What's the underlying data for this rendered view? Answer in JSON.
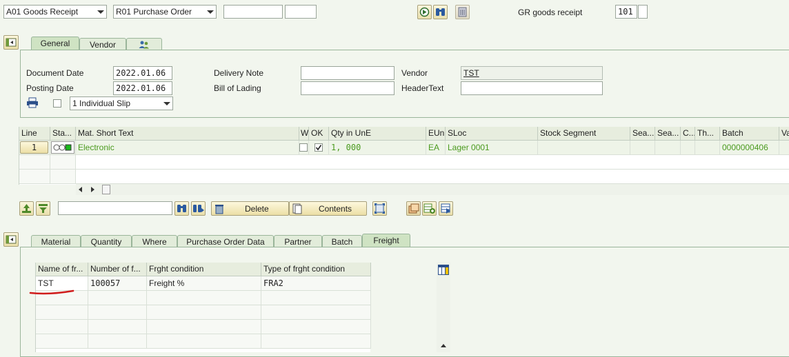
{
  "toolbar": {
    "transaction_select": "A01 Goods Receipt",
    "reference_select": "R01 Purchase Order",
    "ref_input_1": "",
    "ref_input_2": "",
    "movement_label": "GR goods receipt",
    "movement_type": "101"
  },
  "header_tabs": [
    "General",
    "Vendor",
    ""
  ],
  "header": {
    "document_date_label": "Document Date",
    "document_date": "2022.01.06",
    "posting_date_label": "Posting Date",
    "posting_date": "2022.01.06",
    "delivery_note_label": "Delivery Note",
    "delivery_note": "",
    "bill_of_lading_label": "Bill of Lading",
    "bill_of_lading": "",
    "vendor_label": "Vendor",
    "vendor": "TST",
    "header_text_label": "HeaderText",
    "header_text": "",
    "print_select": "1 Individual Slip"
  },
  "items_table": {
    "headers": [
      "Line",
      "Sta...",
      "Mat. Short Text",
      "W",
      "OK",
      "Qty in UnE",
      "EUn",
      "SLoc",
      "Stock Segment",
      "Sea...",
      "Sea...",
      "C...",
      "Th...",
      "Batch",
      "Va"
    ],
    "row": {
      "line": "1",
      "short_text": "Electronic",
      "qty": "1, 000",
      "eun": "EA",
      "sloc": "Lager 0001",
      "batch": "0000000406"
    }
  },
  "item_toolbar": {
    "delete_label": "Delete",
    "contents_label": "Contents",
    "search_value": ""
  },
  "detail_tabs": [
    "Material",
    "Quantity",
    "Where",
    "Purchase Order Data",
    "Partner",
    "Batch",
    "Freight"
  ],
  "freight_table": {
    "headers": [
      "Name of fr...",
      "Number of f...",
      "Frght condition",
      "Type of frght condition"
    ],
    "row": {
      "name": "TST",
      "number": "100057",
      "condition": "Freight %",
      "type": "FRA2"
    }
  },
  "colors": {
    "accent_green": "#4a9a1e",
    "annotation_red": "#d01c1c",
    "background": "#f2f6ee"
  }
}
